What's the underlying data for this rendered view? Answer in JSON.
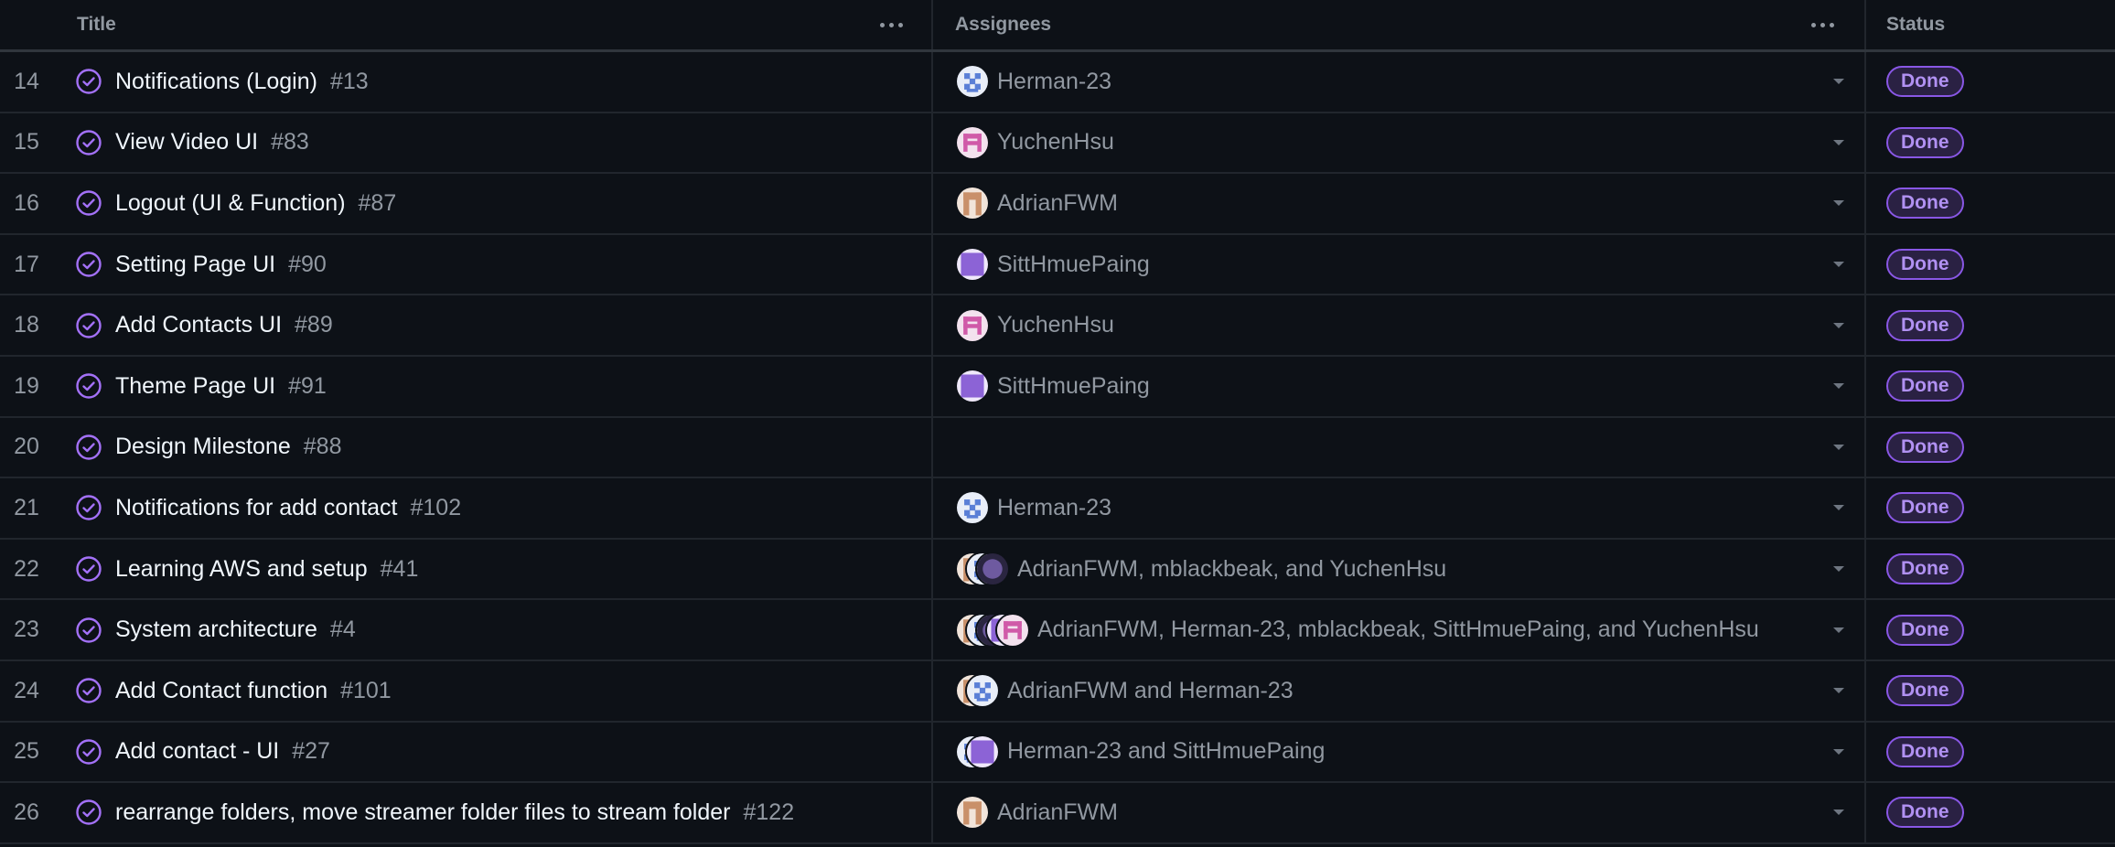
{
  "header": {
    "title_label": "Title",
    "assignees_label": "Assignees",
    "status_label": "Status"
  },
  "colors": {
    "background": "#0d1117",
    "done_purple": "#8957e5",
    "avatar_herman": "#5b7fd6",
    "avatar_yuchen": "#d05aa8",
    "avatar_adrian": "#c9906a",
    "avatar_sitt": "#8c63d6",
    "avatar_mblack": "#6e5aa0"
  },
  "icons": {
    "row_state": "check-circle-icon",
    "more": "more-horizontal-icon",
    "dropdown": "chevron-down-icon"
  },
  "rows": [
    {
      "num": "14",
      "title": "Notifications (Login)",
      "issue": "#13",
      "avatars": [
        "herman"
      ],
      "assignees": "Herman-23",
      "status": "Done"
    },
    {
      "num": "15",
      "title": "View Video UI",
      "issue": "#83",
      "avatars": [
        "yuchen"
      ],
      "assignees": "YuchenHsu",
      "status": "Done"
    },
    {
      "num": "16",
      "title": "Logout (UI & Function)",
      "issue": "#87",
      "avatars": [
        "adrian"
      ],
      "assignees": "AdrianFWM",
      "status": "Done"
    },
    {
      "num": "17",
      "title": "Setting Page UI",
      "issue": "#90",
      "avatars": [
        "sitt"
      ],
      "assignees": "SittHmuePaing",
      "status": "Done"
    },
    {
      "num": "18",
      "title": "Add Contacts UI",
      "issue": "#89",
      "avatars": [
        "yuchen"
      ],
      "assignees": "YuchenHsu",
      "status": "Done"
    },
    {
      "num": "19",
      "title": "Theme Page UI",
      "issue": "#91",
      "avatars": [
        "sitt"
      ],
      "assignees": "SittHmuePaing",
      "status": "Done"
    },
    {
      "num": "20",
      "title": "Design Milestone",
      "issue": "#88",
      "avatars": [],
      "assignees": "",
      "status": "Done"
    },
    {
      "num": "21",
      "title": "Notifications for add contact",
      "issue": "#102",
      "avatars": [
        "herman"
      ],
      "assignees": "Herman-23",
      "status": "Done"
    },
    {
      "num": "22",
      "title": "Learning AWS and setup",
      "issue": "#41",
      "avatars": [
        "adrian",
        "herman",
        "mblack"
      ],
      "assignees": "AdrianFWM, mblackbeak, and YuchenHsu",
      "status": "Done"
    },
    {
      "num": "23",
      "title": "System architecture",
      "issue": "#4",
      "avatars": [
        "adrian",
        "herman",
        "mblack",
        "sitt",
        "yuchen"
      ],
      "assignees": "AdrianFWM, Herman-23, mblackbeak, SittHmuePaing, and YuchenHsu",
      "status": "Done"
    },
    {
      "num": "24",
      "title": "Add Contact function",
      "issue": "#101",
      "avatars": [
        "adrian",
        "herman"
      ],
      "assignees": "AdrianFWM and Herman-23",
      "status": "Done"
    },
    {
      "num": "25",
      "title": "Add contact - UI",
      "issue": "#27",
      "avatars": [
        "herman",
        "sitt"
      ],
      "assignees": "Herman-23 and SittHmuePaing",
      "status": "Done"
    },
    {
      "num": "26",
      "title": "rearrange folders, move streamer folder files to stream folder",
      "issue": "#122",
      "avatars": [
        "adrian"
      ],
      "assignees": "AdrianFWM",
      "status": "Done"
    }
  ]
}
